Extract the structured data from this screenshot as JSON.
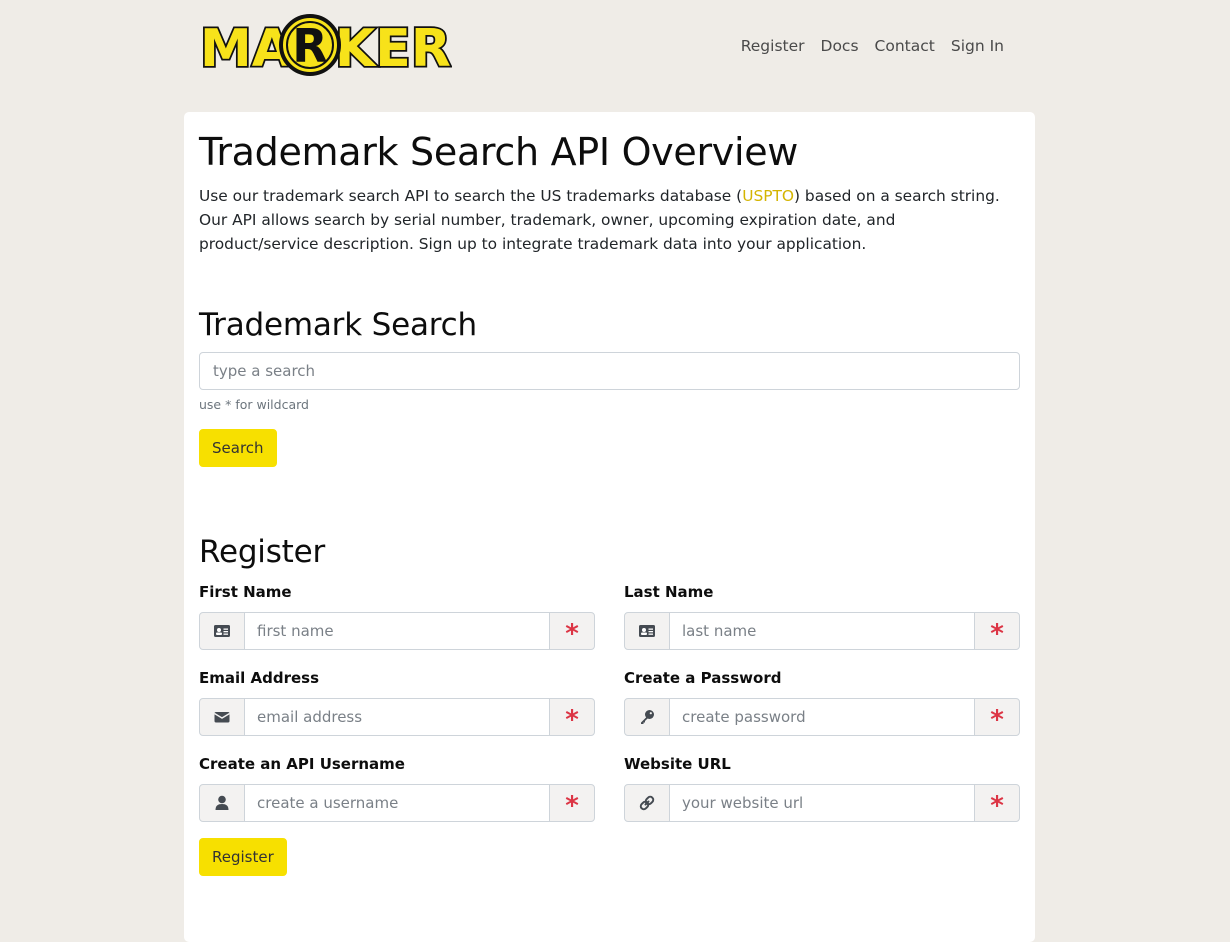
{
  "header": {
    "logo_text": "MARKER",
    "nav": [
      {
        "label": "Register"
      },
      {
        "label": "Docs"
      },
      {
        "label": "Contact"
      },
      {
        "label": "Sign In"
      }
    ]
  },
  "overview": {
    "title": "Trademark Search API Overview",
    "intro_before_link": "Use our trademark search API to search the US trademarks database (",
    "link_text": "USPTO",
    "intro_after_link": ") based on a search string. Our API allows search by serial number, trademark, owner, upcoming expiration date, and product/service description. Sign up to integrate trademark data into your application."
  },
  "search": {
    "title": "Trademark Search",
    "placeholder": "type a search",
    "hint": "use * for wildcard",
    "button_label": "Search"
  },
  "register": {
    "title": "Register",
    "required_marker": "*",
    "fields": {
      "first_name": {
        "label": "First Name",
        "placeholder": "first name",
        "icon": "id-card-icon"
      },
      "last_name": {
        "label": "Last Name",
        "placeholder": "last name",
        "icon": "id-card-icon"
      },
      "email": {
        "label": "Email Address",
        "placeholder": "email address",
        "icon": "envelope-icon"
      },
      "password": {
        "label": "Create a Password",
        "placeholder": "create password",
        "icon": "key-icon"
      },
      "username": {
        "label": "Create an API Username",
        "placeholder": "create a username",
        "icon": "user-icon"
      },
      "website": {
        "label": "Website URL",
        "placeholder": "your website url",
        "icon": "link-icon"
      }
    },
    "button_label": "Register"
  },
  "colors": {
    "page_background": "#efece7",
    "brand_yellow": "#f7e000",
    "link_yellow": "#d4b400",
    "required_red": "#dc3545"
  }
}
